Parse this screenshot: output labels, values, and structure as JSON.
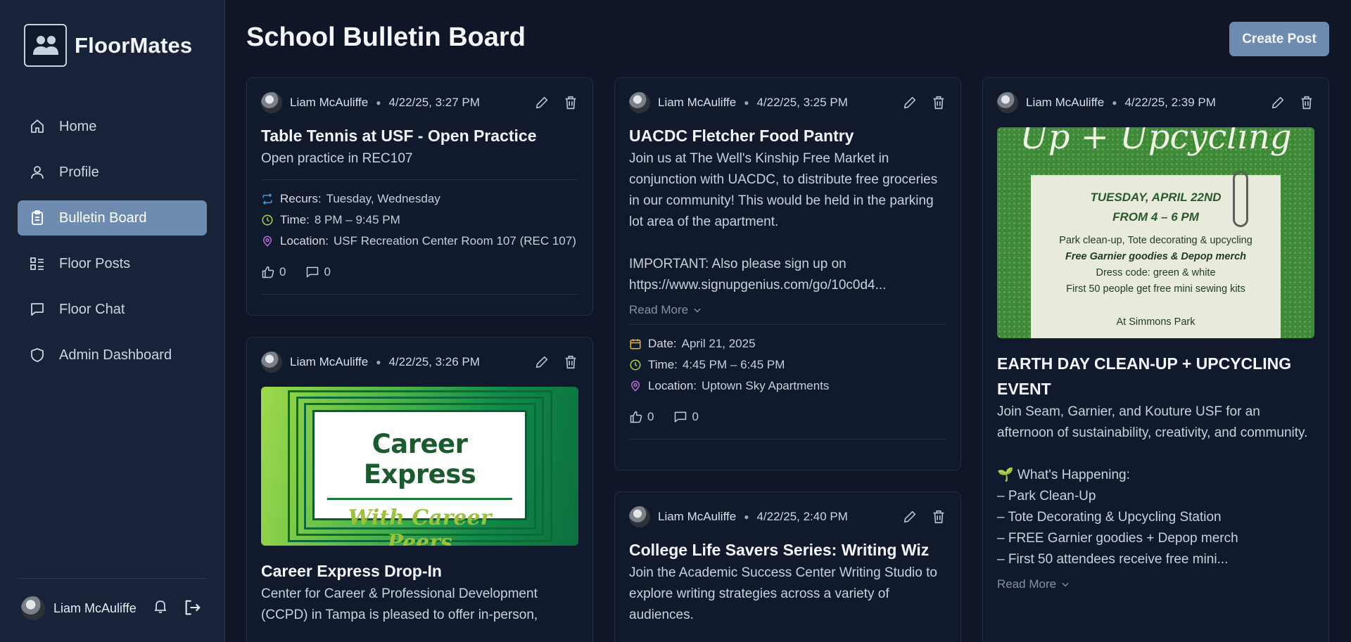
{
  "app": {
    "name": "FloorMates"
  },
  "sidebar": {
    "items": [
      {
        "label": "Home",
        "icon": "home-icon"
      },
      {
        "label": "Profile",
        "icon": "user-icon"
      },
      {
        "label": "Bulletin Board",
        "icon": "clipboard-icon",
        "active": true
      },
      {
        "label": "Floor Posts",
        "icon": "list-icon"
      },
      {
        "label": "Floor Chat",
        "icon": "chat-icon"
      },
      {
        "label": "Admin Dashboard",
        "icon": "shield-icon"
      }
    ],
    "user": {
      "name": "Liam McAuliffe"
    }
  },
  "header": {
    "title": "School Bulletin Board",
    "create_label": "Create Post"
  },
  "colors": {
    "accent": "#6f8bb0",
    "recur": "#3b9be0",
    "time": "#a6d64a",
    "location": "#c06ad8",
    "date": "#e7b43a"
  },
  "posts": [
    {
      "author": "Liam McAuliffe",
      "timestamp": "4/22/25, 3:27 PM",
      "title": "Table Tennis at USF - Open Practice",
      "desc": "Open practice in REC107",
      "meta": [
        {
          "label": "Recurs:",
          "value": "Tuesday, Wednesday"
        },
        {
          "label": "Time:",
          "value": "8 PM – 9:45 PM"
        },
        {
          "label": "Location:",
          "value": "USF Recreation Center Room 107 (REC 107)"
        }
      ],
      "likes": "0",
      "comments": "0"
    },
    {
      "author": "Liam McAuliffe",
      "timestamp": "4/22/25, 3:26 PM",
      "image": {
        "title": "Career Express",
        "subtitle": "With Career Peers"
      },
      "title": "Career Express Drop-In",
      "desc": "Center for Career & Professional Development (CCPD) in Tampa is pleased to offer in-person,"
    },
    {
      "author": "Liam McAuliffe",
      "timestamp": "4/22/25, 3:25 PM",
      "title": "UACDC Fletcher Food Pantry",
      "desc": "Join us at The Well's Kinship Free Market in conjunction with UACDC, to distribute free groceries in our community! This would be held in the parking lot area of the apartment.\n\nIMPORTANT: Also please sign up on https://www.signupgenius.com/go/10c0d4...",
      "read_more": "Read More",
      "meta": [
        {
          "label": "Date:",
          "value": "April 21, 2025"
        },
        {
          "label": "Time:",
          "value": "4:45 PM – 6:45 PM"
        },
        {
          "label": "Location:",
          "value": "Uptown Sky Apartments"
        }
      ],
      "likes": "0",
      "comments": "0"
    },
    {
      "author": "Liam McAuliffe",
      "timestamp": "4/22/25, 2:40 PM",
      "title": "College Life Savers Series: Writing Wiz",
      "desc": "Join the Academic Success Center Writing Studio to explore writing strategies across a variety of audiences."
    },
    {
      "author": "Liam McAuliffe",
      "timestamp": "4/22/25, 2:39 PM",
      "image": {
        "top": "Up + Upcycling",
        "line1": "TUESDAY, APRIL 22ND",
        "line2": "FROM 4 – 6 PM",
        "line3": "Park clean-up, Tote decorating & upcycling",
        "line4": "Free Garnier goodies & Depop merch",
        "line5": "Dress code: green & white",
        "line6": "First 50 people get free mini sewing kits",
        "line7": "At Simmons Park"
      },
      "title": "EARTH DAY CLEAN-UP + UPCYCLING EVENT",
      "desc": "Join Seam, Garnier, and Kouture USF for an afternoon of sustainability, creativity, and community.\n\n🌱 What's Happening:\n– Park Clean-Up\n– Tote Decorating & Upcycling Station\n– FREE Garnier goodies + Depop merch\n– First 50 attendees receive free mini...",
      "read_more": "Read More"
    }
  ]
}
